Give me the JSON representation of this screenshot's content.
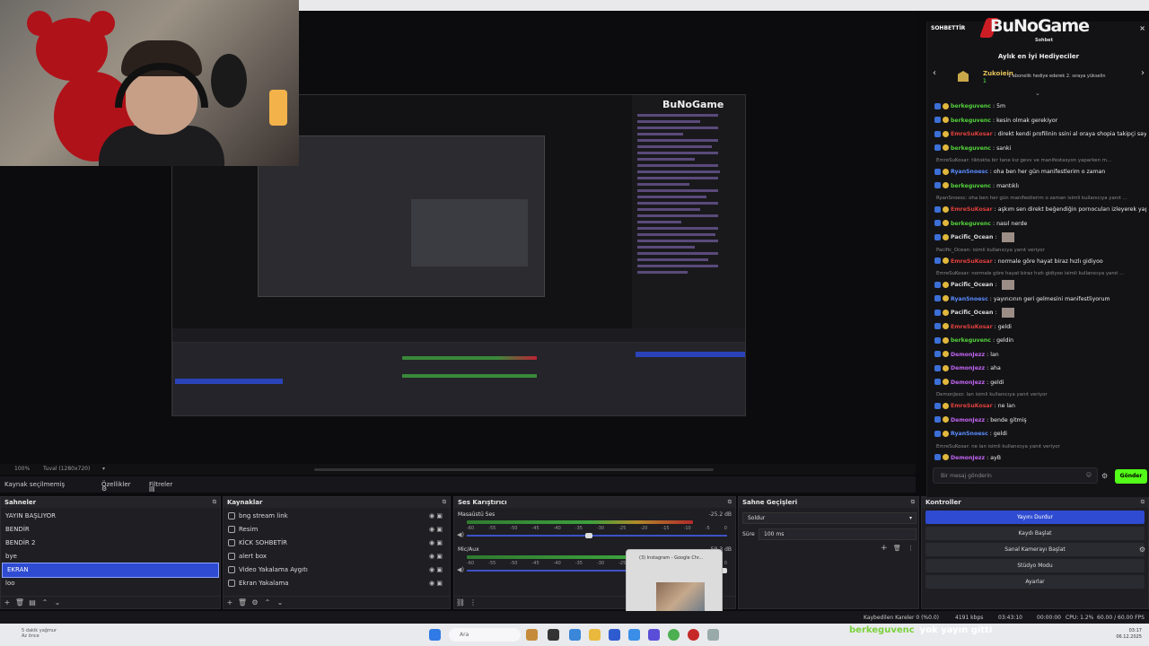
{
  "preview": {
    "zoom": "100%",
    "canvas": "Tuval (1280x720)"
  },
  "nested_brand": "BuNoGame",
  "source_toolbar": {
    "no_source": "Kaynak seçilmemiş",
    "properties": "Özellikler",
    "filters": "Filtreler"
  },
  "scenes": {
    "title": "Sahneler",
    "items": [
      "YAYIN BAŞLIYOR",
      "BENDİR",
      "BENDİR 2",
      "bye",
      "EKRAN",
      "loo"
    ],
    "selected": "EKRAN"
  },
  "sources": {
    "title": "Kaynaklar",
    "items": [
      "bng stream link",
      "Resim",
      "KİCK SOHBETİR",
      "alert box",
      "Video Yakalama Aygıtı",
      "Ekran Yakalama"
    ]
  },
  "mixer": {
    "title": "Ses Karıştırıcı",
    "channels": [
      {
        "name": "Masaüstü Ses",
        "db": "-25.2 dB",
        "level": 0.87
      },
      {
        "name": "Mic/Aux",
        "db": "-59.3 dB",
        "level": 0.62
      }
    ],
    "ticks": [
      "-60",
      "-55",
      "-50",
      "-45",
      "-40",
      "-35",
      "-30",
      "-25",
      "-20",
      "-15",
      "-10",
      "-5",
      "0"
    ]
  },
  "transitions": {
    "title": "Sahne Geçişleri",
    "type": "Soldur",
    "duration_label": "Süre",
    "duration": "100 ms"
  },
  "controls": {
    "title": "Kontroller",
    "buttons": [
      "Yayını Durdur",
      "Kaydı Başlat",
      "Sanal Kamerayı Başlat",
      "Stüdyo Modu",
      "Ayarlar"
    ]
  },
  "chat": {
    "header": "SOHBETTİR",
    "brand": "BuNoGame",
    "brand_sub": "Sohbet",
    "gift_title": "Aylık en İyi Hediyeciler",
    "gifter": "Zukoiein",
    "gifter_count": "1",
    "gifter_info": "1 abonelik hediye ederek 2. sıraya yükselin",
    "input_placeholder": "Bir mesaj gönderin",
    "send": "Gönder",
    "messages": [
      {
        "user": "berkeguvenc",
        "text": "5m",
        "color": "#53d13b"
      },
      {
        "user": "berkeguvenc",
        "text": "kesin olmak gerekiyor",
        "color": "#53d13b"
      },
      {
        "user": "EmreSuKosar",
        "text": "direkt kendi profilinin ssini al oraya shopia takipçi sayısını",
        "color": "#e0403c"
      },
      {
        "user": "berkeguvenc",
        "text": "sanki",
        "color": "#53d13b"
      },
      {
        "user": "",
        "text": "EmreSuKosar: tiktokta bir tane kız gevv ve manifestasyon yaparken m...",
        "color": "#888",
        "reply": true
      },
      {
        "user": "RyanSnoesc",
        "text": "oha ben her gün manifestlerim o zaman",
        "color": "#5a8cff"
      },
      {
        "user": "berkeguvenc",
        "text": "mantıklı",
        "color": "#53d13b"
      },
      {
        "user": "",
        "text": "RyanSnoesc: oha ben her gün manifestlerim o zaman isimli kullanıcıya yanıt ...",
        "color": "#888",
        "reply": true
      },
      {
        "user": "EmreSuKosar",
        "text": "aşkım sen direkt beğendiğin pornocuları izleyerek yap",
        "color": "#e0403c"
      },
      {
        "user": "berkeguvenc",
        "text": "nasıl nerde",
        "color": "#53d13b"
      },
      {
        "user": "Pacific_Ocean",
        "text": "",
        "color": "#d9d9d9",
        "emote": true
      },
      {
        "user": "",
        "text": "Pacific_Ocean: isimli kullanıcıya yanıt veriyor",
        "color": "#888",
        "reply": true
      },
      {
        "user": "EmreSuKosar",
        "text": "normale göre hayat biraz hızlı gidiyoo",
        "color": "#e0403c"
      },
      {
        "user": "",
        "text": "EmreSuKosar: normale göre hayat biraz hızlı gidiyoo isimli kullanıcıya yanıt ...",
        "color": "#888",
        "reply": true
      },
      {
        "user": "Pacific_Ocean",
        "text": "",
        "color": "#d9d9d9",
        "emote": true
      },
      {
        "user": "RyanSnoesc",
        "text": "yayıncının geri gelmesini manifestliyorum",
        "color": "#5a8cff"
      },
      {
        "user": "Pacific_Ocean",
        "text": "",
        "color": "#d9d9d9",
        "emote": true
      },
      {
        "user": "EmreSuKosar",
        "text": "geldi",
        "color": "#e0403c"
      },
      {
        "user": "berkeguvenc",
        "text": "geldin",
        "color": "#53d13b"
      },
      {
        "user": "DemonJezz",
        "text": "lan",
        "color": "#c064f0"
      },
      {
        "user": "DemonJezz",
        "text": "aha",
        "color": "#c064f0"
      },
      {
        "user": "DemonJezz",
        "text": "geldi",
        "color": "#c064f0"
      },
      {
        "user": "",
        "text": "DemonJezz: lan isimli kullanıcıya yanıt veriyor",
        "color": "#888",
        "reply": true
      },
      {
        "user": "EmreSuKosar",
        "text": "ne lan",
        "color": "#e0403c"
      },
      {
        "user": "DemonJezz",
        "text": "bende gitmiş",
        "color": "#c064f0"
      },
      {
        "user": "RyanSnoesc",
        "text": "geldi",
        "color": "#5a8cff"
      },
      {
        "user": "",
        "text": "EmreSuKosar: ne lan isimli kullanıcıya yanıt veriyor",
        "color": "#888",
        "reply": true
      },
      {
        "user": "DemonJezz",
        "text": "ayB",
        "color": "#c064f0"
      },
      {
        "user": "berkeguvenc",
        "text": "yok yayın gitti",
        "color": "#53d13b"
      }
    ]
  },
  "popup": {
    "title": "(3) Instagram - Google Chr..."
  },
  "statusbar": {
    "dropped": "Kaybedilen Kareler 0 (%0.0)",
    "bitrate": "4191 kbps",
    "live_time": "03:43:10",
    "rec_time": "00:00:00",
    "cpu": "CPU: 1.2%",
    "fps": "60.00 / 60.00 FPS"
  },
  "taskbar": {
    "notice_title": "5 dakik yağmur",
    "notice_sub": "Az önce",
    "search": "Ara",
    "time": "03:17",
    "date": "06.12.2025"
  },
  "overlay": {
    "user": "berkeguvenc",
    "text": "yok yayın gitti"
  },
  "colors": {
    "accent": "#2e4bd1",
    "kick_green": "#53fc18"
  }
}
